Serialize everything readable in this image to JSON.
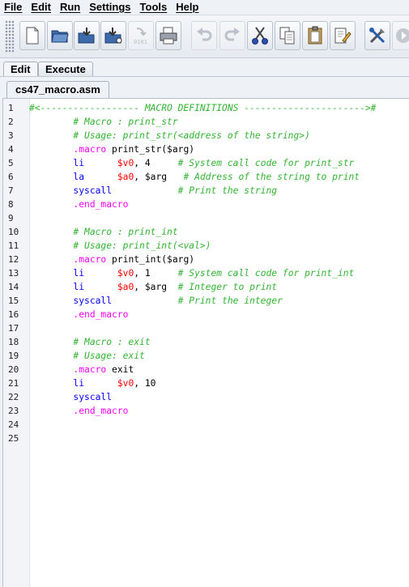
{
  "menu": [
    "File",
    "Edit",
    "Run",
    "Settings",
    "Tools",
    "Help"
  ],
  "toolbar_icons": [
    "new-file-icon",
    "open-folder-icon",
    "save-icon",
    "save-as-icon",
    "dump-memory-icon",
    "print-icon",
    "undo-icon",
    "redo-icon",
    "cut-icon",
    "copy-icon",
    "paste-icon",
    "find-replace-icon",
    "assemble-icon",
    "run-icon"
  ],
  "tabs": {
    "edit": "Edit",
    "execute": "Execute"
  },
  "file_tab": "cs47_macro.asm",
  "lines": [
    {
      "n": "1",
      "seg": [
        {
          "t": "#<------------------ MACRO DEFINITIONS ---------------------->#",
          "c": "comment"
        }
      ]
    },
    {
      "n": "2",
      "seg": [
        {
          "t": "        ",
          "c": "text"
        },
        {
          "t": "# Macro : print_str",
          "c": "comment"
        }
      ]
    },
    {
      "n": "3",
      "seg": [
        {
          "t": "        ",
          "c": "text"
        },
        {
          "t": "# Usage: print_str(<address of the string>)",
          "c": "comment"
        }
      ]
    },
    {
      "n": "4",
      "seg": [
        {
          "t": "        ",
          "c": "text"
        },
        {
          "t": ".macro",
          "c": "dir"
        },
        {
          "t": " print_str($arg)",
          "c": "text"
        }
      ]
    },
    {
      "n": "5",
      "seg": [
        {
          "t": "        ",
          "c": "text"
        },
        {
          "t": "li",
          "c": "op"
        },
        {
          "t": "      ",
          "c": "text"
        },
        {
          "t": "$v0",
          "c": "reg"
        },
        {
          "t": ", 4     ",
          "c": "text"
        },
        {
          "t": "# System call code for print_str",
          "c": "comment"
        }
      ]
    },
    {
      "n": "6",
      "seg": [
        {
          "t": "        ",
          "c": "text"
        },
        {
          "t": "la",
          "c": "op"
        },
        {
          "t": "      ",
          "c": "text"
        },
        {
          "t": "$a0",
          "c": "reg"
        },
        {
          "t": ", $arg   ",
          "c": "text"
        },
        {
          "t": "# Address of the string to print",
          "c": "comment"
        }
      ]
    },
    {
      "n": "7",
      "seg": [
        {
          "t": "        ",
          "c": "text"
        },
        {
          "t": "syscall",
          "c": "op"
        },
        {
          "t": "            ",
          "c": "text"
        },
        {
          "t": "# Print the string",
          "c": "comment"
        }
      ]
    },
    {
      "n": "8",
      "seg": [
        {
          "t": "        ",
          "c": "text"
        },
        {
          "t": ".end_macro",
          "c": "dir"
        }
      ]
    },
    {
      "n": "9",
      "seg": []
    },
    {
      "n": "10",
      "seg": [
        {
          "t": "        ",
          "c": "text"
        },
        {
          "t": "# Macro : print_int",
          "c": "comment"
        }
      ]
    },
    {
      "n": "11",
      "seg": [
        {
          "t": "        ",
          "c": "text"
        },
        {
          "t": "# Usage: print_int(<val>)",
          "c": "comment"
        }
      ]
    },
    {
      "n": "12",
      "seg": [
        {
          "t": "        ",
          "c": "text"
        },
        {
          "t": ".macro",
          "c": "dir"
        },
        {
          "t": " print_int($arg)",
          "c": "text"
        }
      ]
    },
    {
      "n": "13",
      "seg": [
        {
          "t": "        ",
          "c": "text"
        },
        {
          "t": "li",
          "c": "op"
        },
        {
          "t": "      ",
          "c": "text"
        },
        {
          "t": "$v0",
          "c": "reg"
        },
        {
          "t": ", 1     ",
          "c": "text"
        },
        {
          "t": "# System call code for print_int",
          "c": "comment"
        }
      ]
    },
    {
      "n": "14",
      "seg": [
        {
          "t": "        ",
          "c": "text"
        },
        {
          "t": "li",
          "c": "op"
        },
        {
          "t": "      ",
          "c": "text"
        },
        {
          "t": "$a0",
          "c": "reg"
        },
        {
          "t": ", $arg  ",
          "c": "text"
        },
        {
          "t": "# Integer to print",
          "c": "comment"
        }
      ]
    },
    {
      "n": "15",
      "seg": [
        {
          "t": "        ",
          "c": "text"
        },
        {
          "t": "syscall",
          "c": "op"
        },
        {
          "t": "            ",
          "c": "text"
        },
        {
          "t": "# Print the integer",
          "c": "comment"
        }
      ]
    },
    {
      "n": "16",
      "seg": [
        {
          "t": "        ",
          "c": "text"
        },
        {
          "t": ".end_macro",
          "c": "dir"
        }
      ]
    },
    {
      "n": "17",
      "seg": []
    },
    {
      "n": "18",
      "seg": [
        {
          "t": "        ",
          "c": "text"
        },
        {
          "t": "# Macro : exit",
          "c": "comment"
        }
      ]
    },
    {
      "n": "19",
      "seg": [
        {
          "t": "        ",
          "c": "text"
        },
        {
          "t": "# Usage: exit",
          "c": "comment"
        }
      ]
    },
    {
      "n": "20",
      "seg": [
        {
          "t": "        ",
          "c": "text"
        },
        {
          "t": ".macro",
          "c": "dir"
        },
        {
          "t": " exit",
          "c": "text"
        }
      ]
    },
    {
      "n": "21",
      "seg": [
        {
          "t": "        ",
          "c": "text"
        },
        {
          "t": "li",
          "c": "op"
        },
        {
          "t": "      ",
          "c": "text"
        },
        {
          "t": "$v0",
          "c": "reg"
        },
        {
          "t": ", 10",
          "c": "text"
        }
      ]
    },
    {
      "n": "22",
      "seg": [
        {
          "t": "        ",
          "c": "text"
        },
        {
          "t": "syscall",
          "c": "op"
        }
      ]
    },
    {
      "n": "23",
      "seg": [
        {
          "t": "        ",
          "c": "text"
        },
        {
          "t": ".end_macro",
          "c": "dir"
        }
      ]
    },
    {
      "n": "24",
      "seg": []
    },
    {
      "n": "25",
      "seg": []
    }
  ],
  "colors": {
    "comment": "#32b432",
    "directive": "#ff00ff",
    "register": "#ff0000",
    "instruction": "#0000ff"
  }
}
